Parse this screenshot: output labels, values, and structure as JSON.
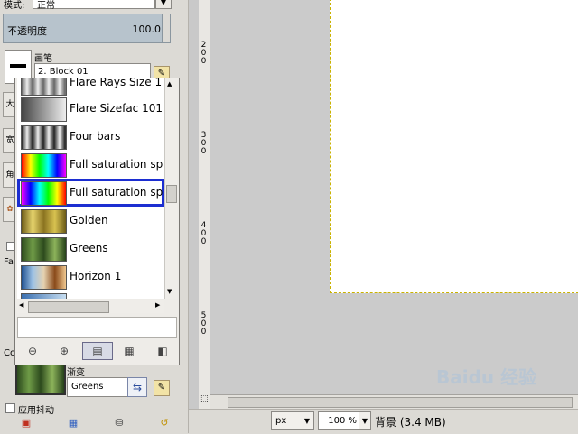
{
  "tool_options": {
    "mode_label": "模式:",
    "mode_value": "正常",
    "opacity_label": "不透明度",
    "opacity_value": "100.0",
    "brush_title": "画笔",
    "brush_value": "2. Block 01",
    "side_tabs": [
      "大",
      "宽",
      "角"
    ],
    "fade_label": "Fa",
    "color_label": "Co",
    "apply_jitter_label": "应用抖动"
  },
  "gradient_popup": {
    "items": [
      {
        "name": "Flare Rays Size 1",
        "swatch": "flare-rays"
      },
      {
        "name": "Flare Sizefac 101",
        "swatch": "flare-sizefac"
      },
      {
        "name": "Four bars",
        "swatch": "four-bars"
      },
      {
        "name": "Full saturation spe",
        "swatch": "full-sat-1"
      },
      {
        "name": "Full saturation spe",
        "swatch": "full-sat-2",
        "selected": true
      },
      {
        "name": "Golden",
        "swatch": "golden"
      },
      {
        "name": "Greens",
        "swatch": "greens"
      },
      {
        "name": "Horizon 1",
        "swatch": "horizon-1"
      }
    ],
    "selection_color": "#1c2ed1"
  },
  "gradient": {
    "title": "渐变",
    "value": "Greens"
  },
  "ruler": {
    "marks": [
      "2\n0\n0",
      "3\n0\n0",
      "4\n0\n0",
      "5\n0\n0"
    ]
  },
  "status_bar": {
    "unit": "px",
    "zoom": "100 %",
    "layer_info": "背景 (3.4 MB)"
  },
  "watermark": "Baidu 经验",
  "colors": {
    "accent_selection": "#1c2ed1",
    "opacity_bar": "#b7c3cc",
    "selection_dash": "#c9b200"
  }
}
